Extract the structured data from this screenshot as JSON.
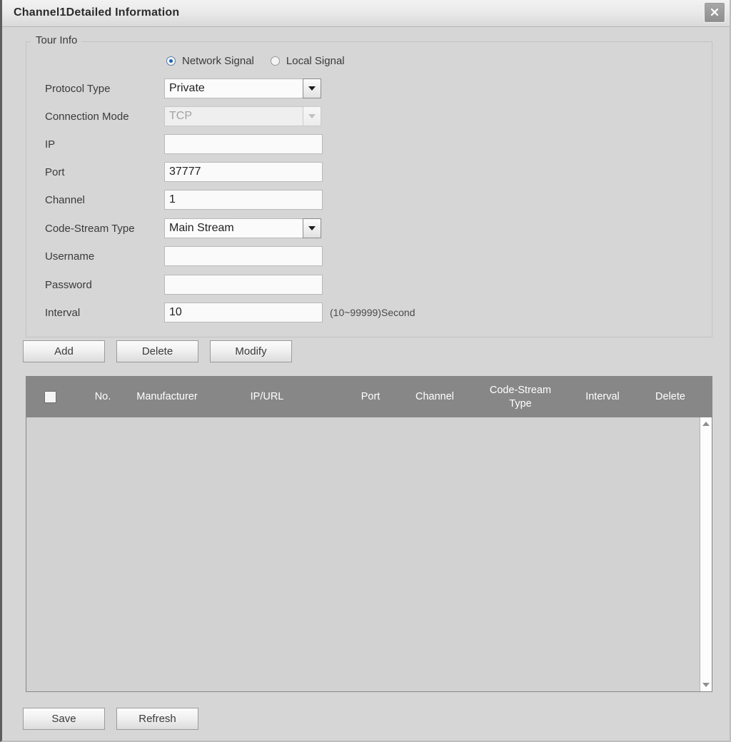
{
  "window": {
    "title": "Channel1Detailed Information",
    "close_icon": "close-icon"
  },
  "fieldset": {
    "legend": "Tour Info"
  },
  "signal": {
    "options": [
      {
        "label": "Network Signal",
        "selected": true
      },
      {
        "label": "Local Signal",
        "selected": false
      }
    ]
  },
  "form": {
    "protocol_type": {
      "label": "Protocol Type",
      "value": "Private",
      "options": [
        "Private"
      ],
      "disabled": false
    },
    "connection_mode": {
      "label": "Connection Mode",
      "value": "TCP",
      "options": [
        "TCP"
      ],
      "disabled": true
    },
    "ip": {
      "label": "IP",
      "value": "",
      "placeholder": ""
    },
    "port": {
      "label": "Port",
      "value": "37777",
      "placeholder": ""
    },
    "channel": {
      "label": "Channel",
      "value": "1",
      "placeholder": ""
    },
    "code_stream_type": {
      "label": "Code-Stream Type",
      "value": "Main Stream",
      "options": [
        "Main Stream"
      ],
      "disabled": false
    },
    "username": {
      "label": "Username",
      "value": "",
      "placeholder": ""
    },
    "password": {
      "label": "Password",
      "value": "",
      "placeholder": ""
    },
    "interval": {
      "label": "Interval",
      "value": "10",
      "placeholder": "",
      "hint": "(10~99999)Second"
    }
  },
  "actions": {
    "add": "Add",
    "delete": "Delete",
    "modify": "Modify"
  },
  "table": {
    "headers": [
      "No.",
      "Manufacturer",
      "IP/URL",
      "Port",
      "Channel",
      "Code-Stream Type",
      "Interval",
      "Delete"
    ],
    "rows": []
  },
  "footer": {
    "save": "Save",
    "refresh": "Refresh"
  },
  "colors": {
    "window_bg": "#d6d6d6",
    "header_bg": "#878787",
    "header_text": "#ffffff",
    "radio_accent": "#1565c0",
    "input_bg": "#fafafa",
    "border": "#b9b9b9"
  }
}
